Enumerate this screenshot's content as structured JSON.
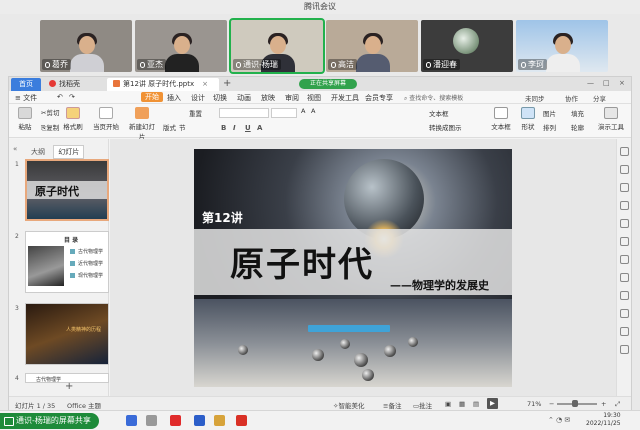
{
  "meeting": {
    "title": "腾讯会议",
    "participants": [
      {
        "name": "葛乔",
        "active": false
      },
      {
        "name": "亚杰",
        "active": false
      },
      {
        "name": "通识-杨瑞",
        "active": true
      },
      {
        "name": "高洁",
        "active": false
      },
      {
        "name": "潘迎春",
        "active": false
      },
      {
        "name": "李珂",
        "active": false
      }
    ],
    "share_banner": "通识-杨瑞的屏幕共享",
    "sharing_pill": "正在共享屏幕"
  },
  "wps": {
    "tabs": {
      "home": "首页",
      "daoke": "找稻壳",
      "document": "第12讲 原子时代.pptx"
    },
    "menu": [
      "文件",
      "开始",
      "插入",
      "设计",
      "切换",
      "动画",
      "放映",
      "审阅",
      "视图",
      "开发工具",
      "会员专享"
    ],
    "active_menu": "开始",
    "search": "查找命令、搜索模板",
    "right_menu": {
      "unsynced": "未同步",
      "collab": "协作",
      "share": "分享"
    },
    "ribbon": {
      "paste": "粘贴",
      "cut": "剪切",
      "copy": "复制",
      "format_painter": "格式刷",
      "play": "当页开始",
      "new_slide": "新建幻灯片",
      "layout": "版式",
      "section": "节",
      "reset": "重置",
      "textbox": "文本框",
      "shape": "形状",
      "arrange": "排列",
      "picture": "图片",
      "fill": "填充",
      "outline": "轮廓",
      "presentation_tools": "演示工具",
      "convert_smartart": "转换成图示",
      "text_box_menu": "文本框",
      "font_size_up": "A",
      "font_size_down": "A"
    },
    "left_panel": {
      "tabs": [
        "大纲",
        "幻灯片"
      ],
      "thumb2_title": "目 录",
      "thumb2_rows": [
        "古代物理学",
        "近代物理学",
        "现代物理学"
      ],
      "thumb3_label": "人类精神的历程",
      "thumb4_label": "古代物理学",
      "numbers": [
        "1",
        "2",
        "3",
        "4"
      ],
      "thumb1_title": "原子时代"
    },
    "slide": {
      "lecture": "第12讲",
      "title": "原子时代",
      "subtitle": "——物理学的发展史"
    },
    "status": {
      "slide_counter": "幻灯片 1 / 35",
      "theme": "Office 主题",
      "beautify": "智能美化",
      "notes": "备注",
      "comments": "批注",
      "zoom": "71%"
    }
  },
  "taskbar": {
    "time": "19:30",
    "date": "2022/11/25"
  },
  "colors": {
    "active_green": "#22b14c",
    "tab_blue": "#3b7ddd",
    "ribbon_orange": "#f09235",
    "share_green": "#1e8b3a"
  }
}
